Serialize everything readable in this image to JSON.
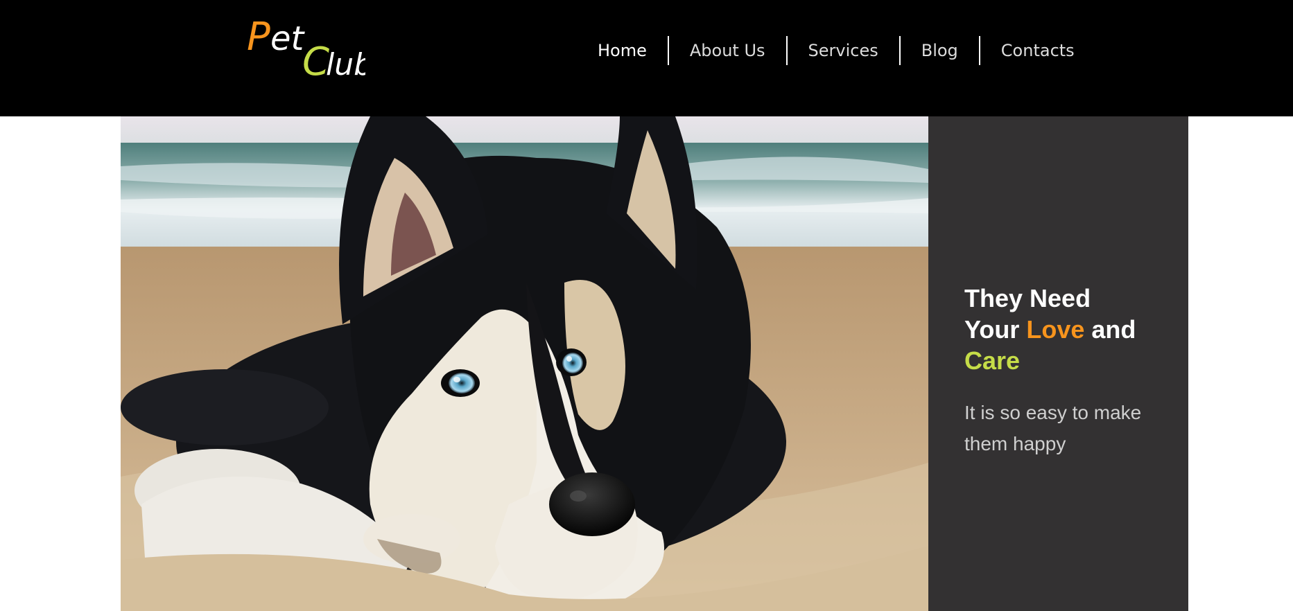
{
  "logo": {
    "pet_first": "P",
    "pet_rest": "et",
    "club_first": "C",
    "club_rest": "lub",
    "colors": {
      "orange": "#f7941d",
      "green": "#c5dc48",
      "white": "#ffffff"
    }
  },
  "nav": {
    "items": [
      {
        "label": "Home",
        "active": true
      },
      {
        "label": "About Us",
        "active": false
      },
      {
        "label": "Services",
        "active": false
      },
      {
        "label": "Blog",
        "active": false
      },
      {
        "label": "Contacts",
        "active": false
      }
    ]
  },
  "hero": {
    "image_icon": "husky-dog-on-beach-photo",
    "headline": {
      "line1": "They Need",
      "line2_start": "Your ",
      "love": "Love",
      "line2_end": " and",
      "care": "Care"
    },
    "subline": "It is so easy to make them happy"
  },
  "colors": {
    "header_bg": "#000000",
    "panel_bg": "#333132",
    "accent_orange": "#f7941d",
    "accent_green": "#c5dc48"
  }
}
